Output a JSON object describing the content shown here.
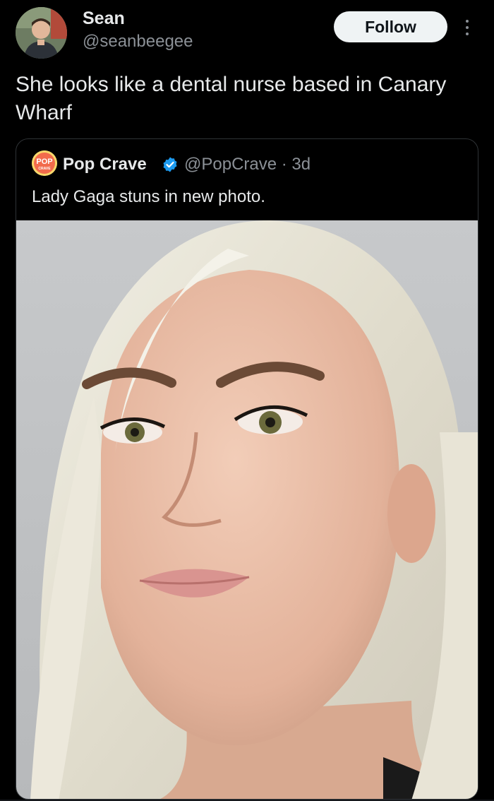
{
  "author": {
    "name": "Sean",
    "handle": "@seanbeegee"
  },
  "follow_label": "Follow",
  "tweet_text": "She looks like a dental nurse based in Canary Wharf",
  "quote": {
    "name": "Pop Crave",
    "handle_time": "@PopCrave · 3d",
    "text": "Lady Gaga stuns in new photo.",
    "avatar_lettering": "POP CRAVE",
    "photo_icon": "portrait-photo"
  },
  "colors": {
    "background": "#000000",
    "text": "#e7e9ea",
    "secondary_text": "#8b9096",
    "border": "#2f3336",
    "verified": "#1d9bf0",
    "follow_bg": "#eff3f4"
  }
}
